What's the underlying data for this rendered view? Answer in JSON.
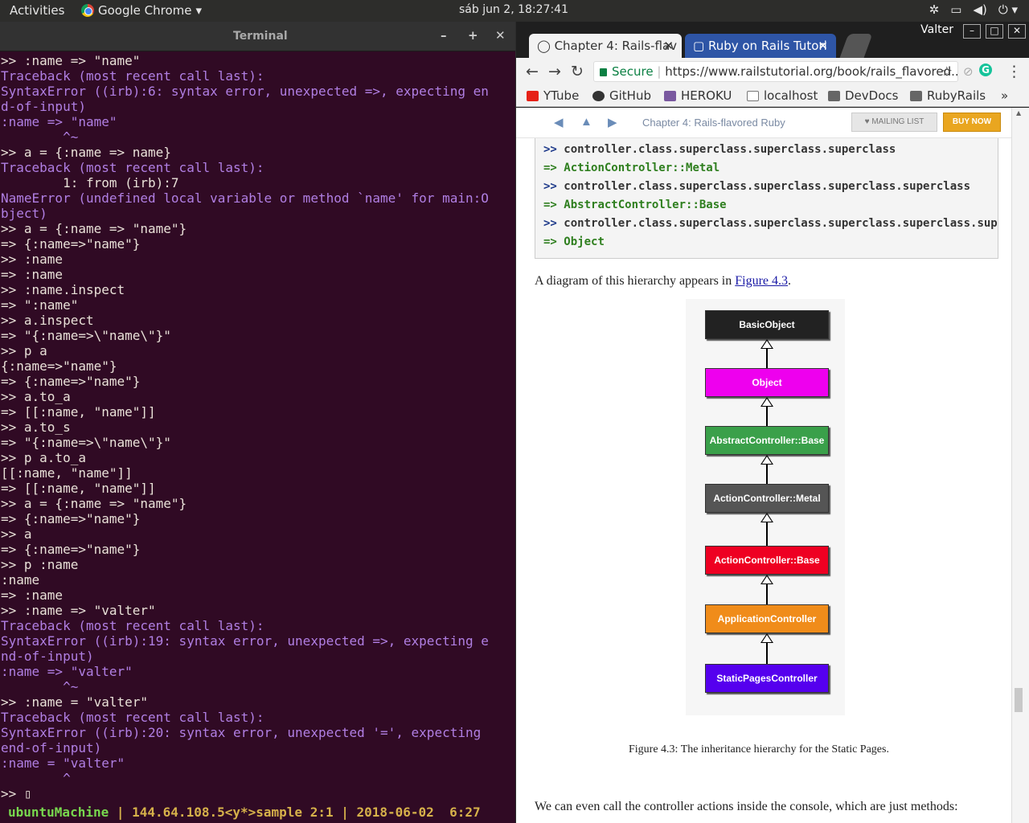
{
  "topbar": {
    "activities": "Activities",
    "app_name": "Google Chrome",
    "clock": "sáb jun  2, 18:27:41"
  },
  "terminal": {
    "title": "Terminal",
    "lines": [
      {
        "text": ">> :name => \"name\"",
        "style": "normal"
      },
      {
        "text": "Traceback (most recent call last):",
        "style": "traceback"
      },
      {
        "text": "SyntaxError ((irb):6: syntax error, unexpected =>, expecting en",
        "style": "error"
      },
      {
        "text": "d-of-input)",
        "style": "error"
      },
      {
        "text": ":name => \"name\"",
        "style": "error"
      },
      {
        "text": "        ^~",
        "style": "error"
      },
      {
        "text": ">> a = {:name => name}",
        "style": "normal"
      },
      {
        "text": "Traceback (most recent call last):",
        "style": "traceback"
      },
      {
        "text": "        1: from (irb):7",
        "style": "normal"
      },
      {
        "text": "NameError (undefined local variable or method `name' for main:O",
        "style": "error"
      },
      {
        "text": "bject)",
        "style": "error"
      },
      {
        "text": ">> a = {:name => \"name\"}",
        "style": "normal"
      },
      {
        "text": "=> {:name=>\"name\"}",
        "style": "normal"
      },
      {
        "text": ">> :name",
        "style": "normal"
      },
      {
        "text": "=> :name",
        "style": "normal"
      },
      {
        "text": ">> :name.inspect",
        "style": "normal"
      },
      {
        "text": "=> \":name\"",
        "style": "normal"
      },
      {
        "text": ">> a.inspect",
        "style": "normal"
      },
      {
        "text": "=> \"{:name=>\\\"name\\\"}\"",
        "style": "normal"
      },
      {
        "text": ">> p a",
        "style": "normal"
      },
      {
        "text": "{:name=>\"name\"}",
        "style": "normal"
      },
      {
        "text": "=> {:name=>\"name\"}",
        "style": "normal"
      },
      {
        "text": ">> a.to_a",
        "style": "normal"
      },
      {
        "text": "=> [[:name, \"name\"]]",
        "style": "normal"
      },
      {
        "text": ">> a.to_s",
        "style": "normal"
      },
      {
        "text": "=> \"{:name=>\\\"name\\\"}\"",
        "style": "normal"
      },
      {
        "text": ">> p a.to_a",
        "style": "normal"
      },
      {
        "text": "[[:name, \"name\"]]",
        "style": "normal"
      },
      {
        "text": "=> [[:name, \"name\"]]",
        "style": "normal"
      },
      {
        "text": ">> a = {:name => \"name\"}",
        "style": "normal"
      },
      {
        "text": "=> {:name=>\"name\"}",
        "style": "normal"
      },
      {
        "text": ">> a",
        "style": "normal"
      },
      {
        "text": "=> {:name=>\"name\"}",
        "style": "normal"
      },
      {
        "text": ">> p :name",
        "style": "normal"
      },
      {
        "text": ":name",
        "style": "normal"
      },
      {
        "text": "=> :name",
        "style": "normal"
      },
      {
        "text": ">> :name => \"valter\"",
        "style": "normal"
      },
      {
        "text": "Traceback (most recent call last):",
        "style": "traceback"
      },
      {
        "text": "SyntaxError ((irb):19: syntax error, unexpected =>, expecting e",
        "style": "error"
      },
      {
        "text": "nd-of-input)",
        "style": "error"
      },
      {
        "text": ":name => \"valter\"",
        "style": "error"
      },
      {
        "text": "        ^~",
        "style": "error"
      },
      {
        "text": ">> :name = \"valter\"",
        "style": "normal"
      },
      {
        "text": "Traceback (most recent call last):",
        "style": "traceback"
      },
      {
        "text": "SyntaxError ((irb):20: syntax error, unexpected '=', expecting ",
        "style": "error"
      },
      {
        "text": "end-of-input)",
        "style": "error"
      },
      {
        "text": ":name = \"valter\"",
        "style": "error"
      },
      {
        "text": "        ^",
        "style": "error"
      },
      {
        "text": ">> ▯",
        "style": "normal"
      }
    ],
    "status": {
      "host": "ubuntuMachine",
      "rest": " | 144.64.108.5<y*>sample 2:1 | 2018-06-02  6:27"
    }
  },
  "chrome": {
    "user": "Valter",
    "tabs": [
      {
        "label": "Chapter 4: Rails-flav"
      },
      {
        "label": "Ruby on Rails Tutori"
      }
    ],
    "omnibox": {
      "secure": "Secure",
      "url": "https://www.railstutorial.org/book/rails_flavored..."
    },
    "bookmarks": [
      {
        "label": "YTube",
        "color": "#e62117"
      },
      {
        "label": "GitHub",
        "color": "#333333"
      },
      {
        "label": "HEROKU",
        "color": "#79589f"
      },
      {
        "label": "localhost",
        "color": "#888888"
      },
      {
        "label": "DevDocs",
        "color": "#666666"
      },
      {
        "label": "RubyRails",
        "color": "#666666"
      }
    ],
    "page": {
      "chapter_nav": "Chapter 4: Rails-flavored Ruby",
      "mailing_list": "MAILING LIST",
      "buy_now": "BUY NOW",
      "code_lines": [
        {
          "prompt": ">>",
          "text": "controller.class.superclass.superclass.superclass",
          "kind": "input"
        },
        {
          "prompt": "=>",
          "text": "ActionController::Metal",
          "kind": "result"
        },
        {
          "prompt": ">>",
          "text": "controller.class.superclass.superclass.superclass.superclass",
          "kind": "input"
        },
        {
          "prompt": "=>",
          "text": "AbstractController::Base",
          "kind": "result"
        },
        {
          "prompt": ">>",
          "text": "controller.class.superclass.superclass.superclass.superclass.supercla",
          "kind": "input"
        },
        {
          "prompt": "=>",
          "text": "Object",
          "kind": "result"
        }
      ],
      "prose1_before": "A diagram of this hierarchy appears in ",
      "prose1_link": "Figure 4.3",
      "prose1_after": ".",
      "diagram_nodes": [
        {
          "label": "BasicObject",
          "color": "#222222"
        },
        {
          "label": "Object",
          "color": "#ee00ee"
        },
        {
          "label": "AbstractController::Base",
          "color": "#3aa04a"
        },
        {
          "label": "ActionController::Metal",
          "color": "#555555"
        },
        {
          "label": "ActionController::Base",
          "color": "#ee0022"
        },
        {
          "label": "ApplicationController",
          "color": "#f08c1a"
        },
        {
          "label": "StaticPagesController",
          "color": "#5500ee"
        }
      ],
      "caption": "Figure 4.3:   The inheritance hierarchy for the Static Pages.",
      "prose2": "We can even call the controller actions inside the console, which are just methods:"
    }
  }
}
